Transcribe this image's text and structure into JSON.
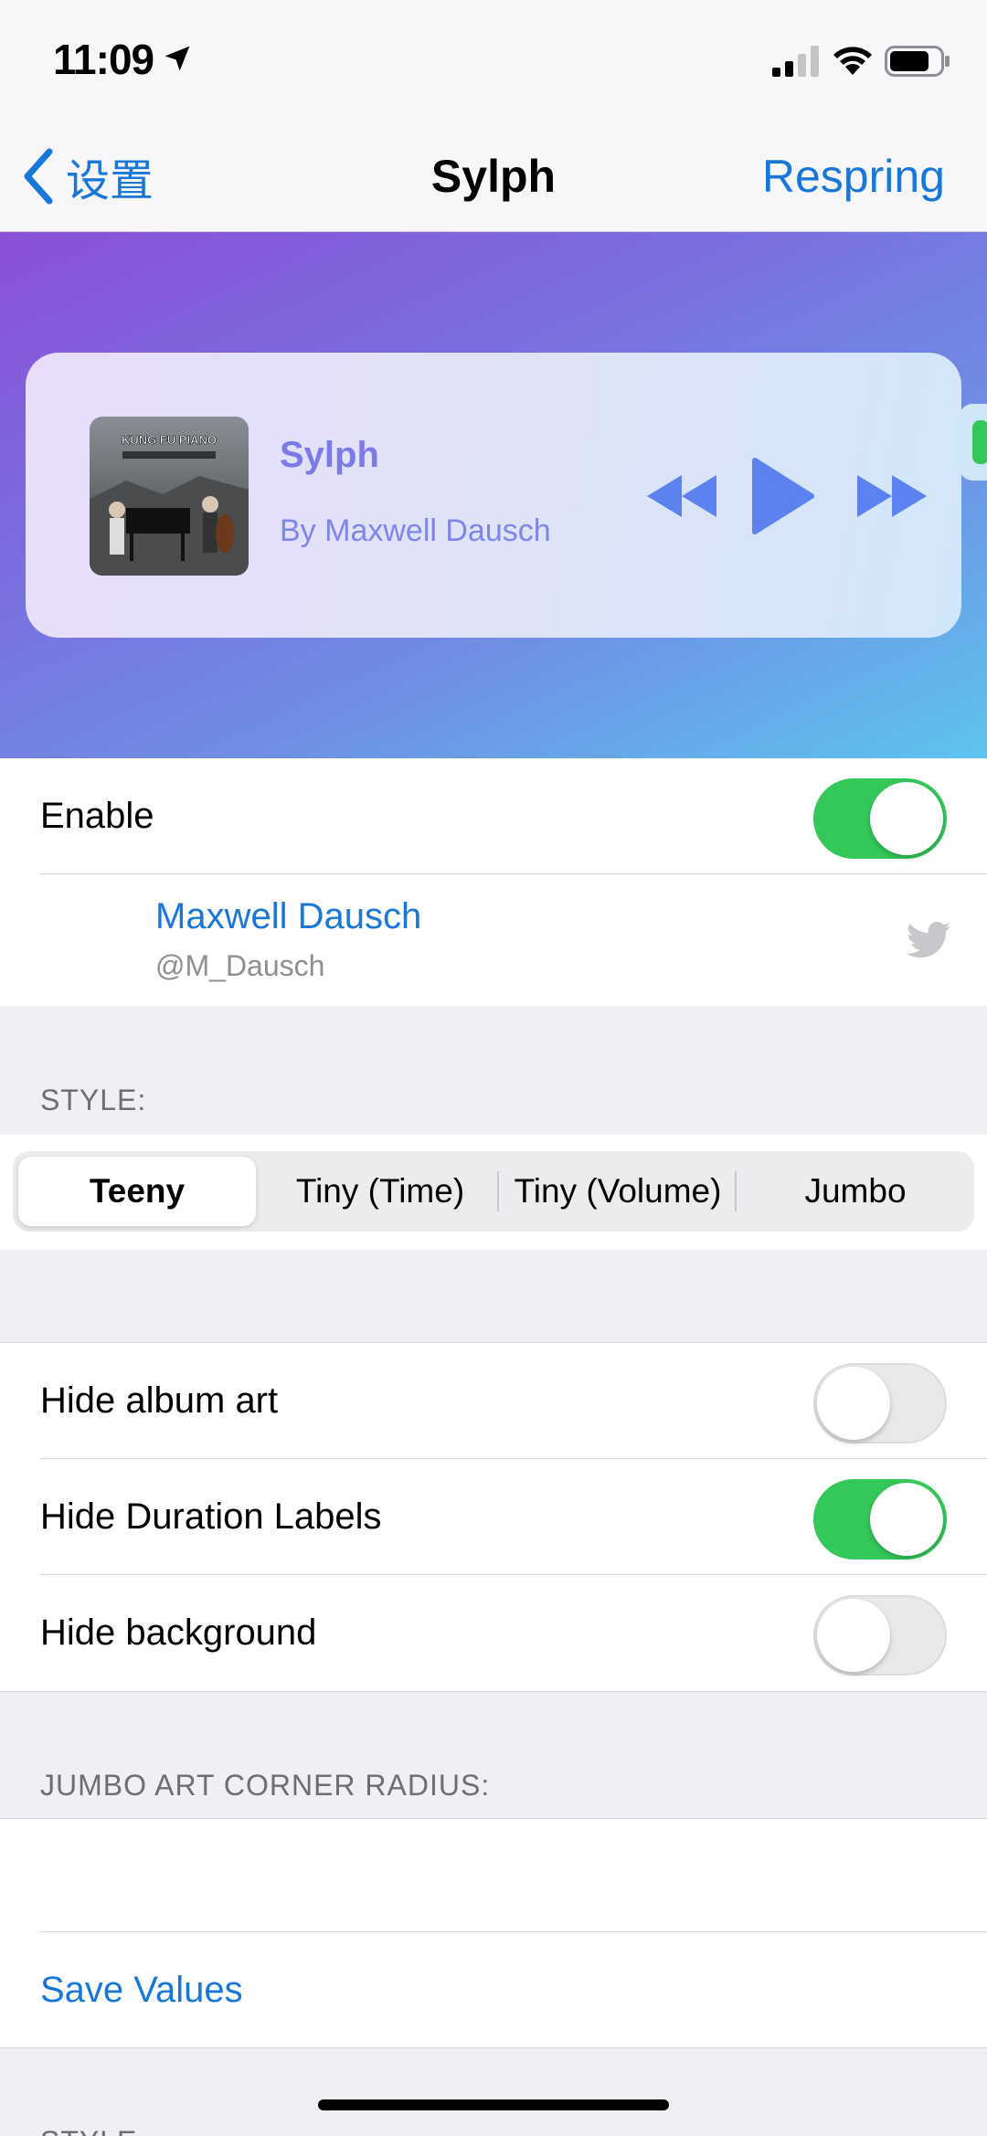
{
  "status_bar": {
    "time": "11:09",
    "icons": [
      "location-arrow-icon",
      "cellular-signal-icon",
      "wifi-icon",
      "battery-icon"
    ]
  },
  "nav": {
    "back_label": "设置",
    "title": "Sylph",
    "action_label": "Respring"
  },
  "player": {
    "title": "Sylph",
    "artist": "By Maxwell Dausch",
    "album_art_text": "KUNG FU PIANO",
    "controls": [
      "rewind-icon",
      "play-icon",
      "fast-forward-icon"
    ]
  },
  "settings": {
    "enable": {
      "label": "Enable",
      "on": true
    },
    "author": {
      "name": "Maxwell Dausch",
      "handle": "@M_Dausch"
    }
  },
  "style_section": {
    "header": "STYLE:",
    "segments": [
      "Teeny",
      "Tiny (Time)",
      "Tiny (Volume)",
      "Jumbo"
    ],
    "selected": "Teeny"
  },
  "toggles": [
    {
      "label": "Hide album art",
      "on": false
    },
    {
      "label": "Hide Duration Labels",
      "on": true
    },
    {
      "label": "Hide background",
      "on": false
    }
  ],
  "corner_radius_section": {
    "header": "JUMBO ART CORNER RADIUS:",
    "save_label": "Save Values"
  },
  "next_section_header": "STYLE:",
  "colors": {
    "accent": "#1877d8",
    "switch_on": "#34c759",
    "player_text": "#7a7ae8"
  }
}
